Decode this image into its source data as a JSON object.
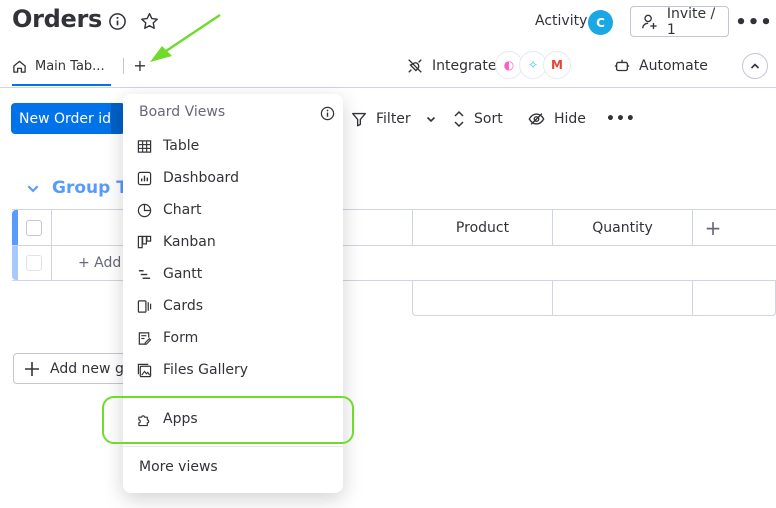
{
  "header": {
    "title": "Orders",
    "activity_label": "Activity",
    "avatar_initial": "C",
    "invite_label": "Invite / 1"
  },
  "tabs": {
    "main_label": "Main Tab...",
    "add_label": "+",
    "integrate_label": "Integrate",
    "automate_label": "Automate"
  },
  "toolbar": {
    "new_item_label": "New Order id",
    "filter_label": "Filter",
    "sort_label": "Sort",
    "hide_label": "Hide"
  },
  "board": {
    "group_title": "Group T",
    "columns": [
      "Product",
      "Quantity"
    ],
    "add_item_label": "+ Add C",
    "add_group_label": "Add new gr"
  },
  "menu": {
    "title": "Board Views",
    "items": [
      {
        "label": "Table",
        "icon": "table-icon"
      },
      {
        "label": "Dashboard",
        "icon": "dashboard-icon"
      },
      {
        "label": "Chart",
        "icon": "chart-icon"
      },
      {
        "label": "Kanban",
        "icon": "kanban-icon"
      },
      {
        "label": "Gantt",
        "icon": "gantt-icon"
      },
      {
        "label": "Cards",
        "icon": "cards-icon"
      },
      {
        "label": "Form",
        "icon": "form-icon"
      },
      {
        "label": "Files Gallery",
        "icon": "files-gallery-icon"
      },
      {
        "label": "Apps",
        "icon": "apps-icon"
      }
    ],
    "more_views_label": "More views"
  },
  "colors": {
    "primary": "#0073ea",
    "group": "#579bfc",
    "highlight": "#6fdc2c",
    "avatar": "#1aa7e6"
  }
}
